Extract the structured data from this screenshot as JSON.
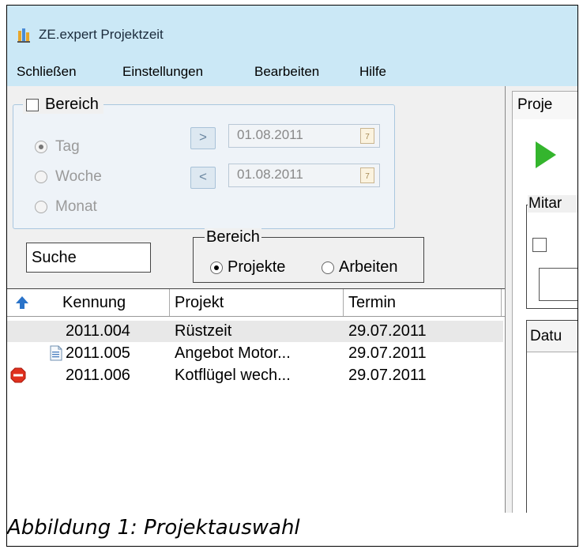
{
  "window": {
    "title": "ZE.expert Projektzeit",
    "icon": "app-icon"
  },
  "menu": [
    "Schließen",
    "Einstellungen",
    "Bearbeiten",
    "Hilfe"
  ],
  "bereich_group": {
    "label": "Bereich",
    "checked": false,
    "options": [
      "Tag",
      "Woche",
      "Monat"
    ],
    "selected": "Tag",
    "next_label": ">",
    "prev_label": "<",
    "date_from": "01.08.2011",
    "date_to": "01.08.2011"
  },
  "search": {
    "value": "Suche"
  },
  "bereich2": {
    "label": "Bereich",
    "options": [
      "Projekte",
      "Arbeiten"
    ],
    "selected": "Projekte"
  },
  "list": {
    "columns": [
      "Kennung",
      "Projekt",
      "Termin"
    ],
    "rows": [
      {
        "kennung": "2011.004",
        "projekt": "Rüstzeit",
        "termin": "29.07.2011",
        "icon": "none"
      },
      {
        "kennung": "2011.005",
        "projekt": "Angebot Motor...",
        "termin": "29.07.2011",
        "icon": "document-icon"
      },
      {
        "kennung": "2011.006",
        "projekt": "Kotflügel wech...",
        "termin": "29.07.2011",
        "icon": "stop-icon"
      }
    ]
  },
  "right": {
    "tab": "Proje",
    "group_label": "Mitar",
    "list_header": "Datu"
  },
  "caption": "Abbildung 1: Projektauswahl",
  "colors": {
    "titlebar": "#cbe8f6",
    "play": "#34b52d",
    "stop": "#e0301e"
  }
}
